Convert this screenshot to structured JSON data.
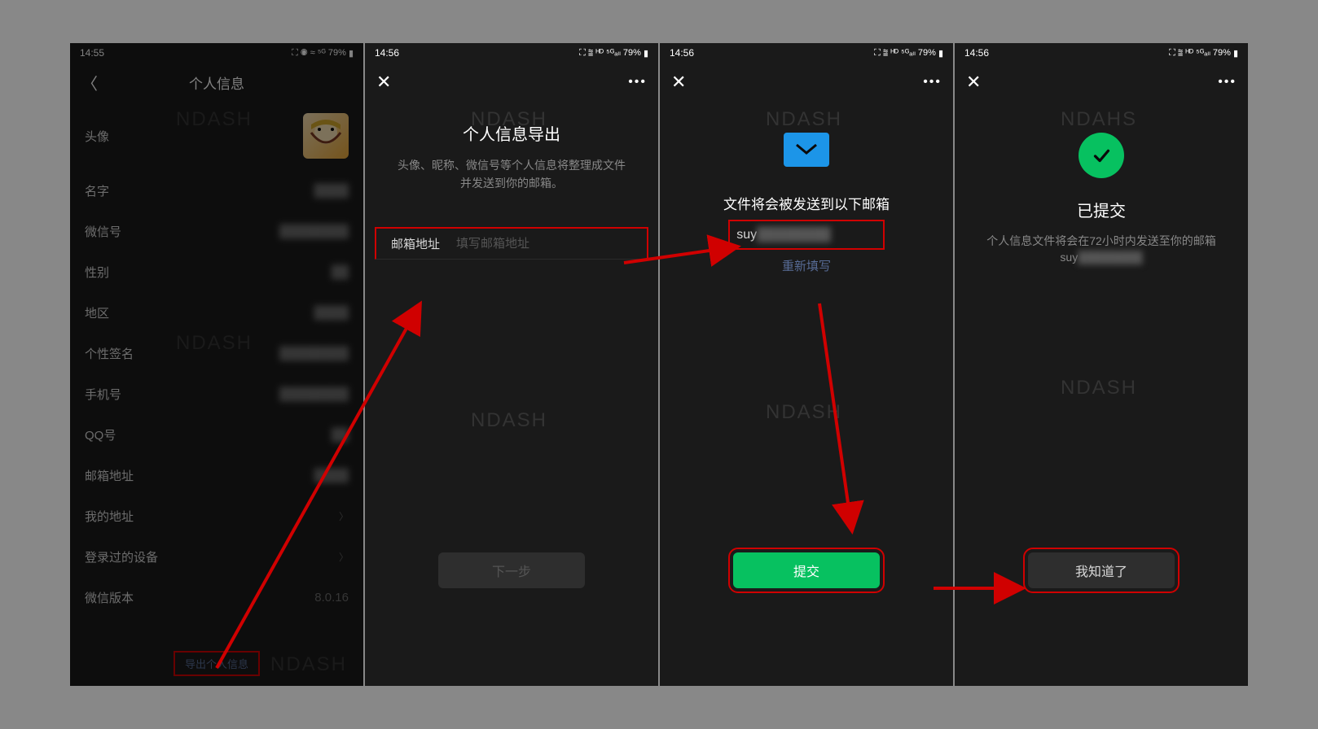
{
  "status": {
    "time": "14:56",
    "time_dim": "14:55",
    "battery": "79%",
    "icons": "⛶ ⛯ ᴴᴰ ⁵ᴳ ᴴᴰ"
  },
  "screen1": {
    "title": "个人信息",
    "watermarks": [
      "NDASH",
      "NDASH",
      "NDASH"
    ],
    "items": [
      {
        "label": "头像"
      },
      {
        "label": "名字"
      },
      {
        "label": "微信号"
      },
      {
        "label": "性别"
      },
      {
        "label": "地区"
      },
      {
        "label": "个性签名"
      },
      {
        "label": "手机号"
      },
      {
        "label": "QQ号"
      },
      {
        "label": "邮箱地址"
      },
      {
        "label": "我的地址"
      },
      {
        "label": "登录过的设备"
      },
      {
        "label": "微信版本"
      }
    ],
    "version": "8.0.16",
    "export_link": "导出个人信息"
  },
  "screen2": {
    "title": "个人信息导出",
    "desc1": "头像、昵称、微信号等个人信息将整理成文件",
    "desc2": "并发送到你的邮箱。",
    "email_label": "邮箱地址",
    "email_placeholder": "填写邮箱地址",
    "next_btn": "下一步",
    "watermarks": [
      "NDASH",
      "NDASH"
    ]
  },
  "screen3": {
    "text1": "文件将会被发送到以下邮箱",
    "email_prefix": "suy",
    "relink": "重新填写",
    "submit_btn": "提交",
    "watermarks": [
      "NDASH",
      "NDASH"
    ]
  },
  "screen4": {
    "submitted": "已提交",
    "desc": "个人信息文件将会在72小时内发送至你的邮箱",
    "email_prefix": "suy",
    "ok_btn": "我知道了",
    "watermarks": [
      "NDAHS",
      "NDASH"
    ]
  }
}
